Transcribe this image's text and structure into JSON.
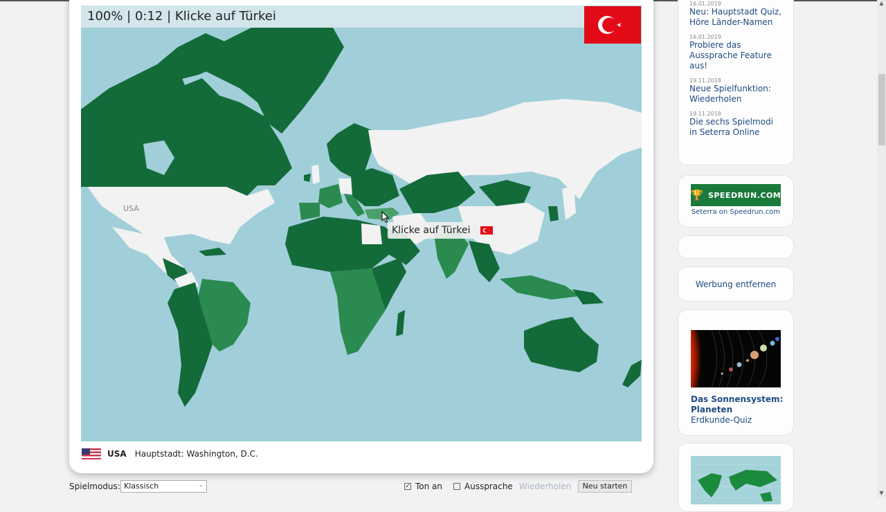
{
  "game": {
    "status_text": "100% | 0:12 | Klicke auf Türkei",
    "score_percent": 100,
    "elapsed_time": "0:12",
    "prompt": "Klicke auf Türkei",
    "target_country": "Türkei",
    "target_flag_icon": "turkey-flag-icon",
    "tooltip_text": "Klicke auf Türkei",
    "map_label_usa": "USA",
    "last_answer": {
      "flag_icon": "usa-flag-icon",
      "country": "USA",
      "capital_text": "Hauptstadt: Washington, D.C."
    },
    "colors": {
      "ocean": "#a0cfd9",
      "correct_first": "#146b3a",
      "correct_later": "#2a8a4f",
      "remaining": "#f2f2f2",
      "hover": "#4aa06a"
    }
  },
  "controls": {
    "mode_label": "Spielmodus:",
    "mode_value": "Klassisch",
    "sound_label": "Ton an",
    "sound_checked": true,
    "pronunciation_label": "Aussprache",
    "pronunciation_checked": false,
    "repeat_label": "Wiederholen",
    "restart_label": "Neu starten"
  },
  "sidebar": {
    "news": [
      {
        "date": "16.01.2019",
        "title": "Neu: Hauptstadt Quiz, Höre Länder-Namen"
      },
      {
        "date": "16.01.2019",
        "title": "Probiere das Aussprache Feature aus!"
      },
      {
        "date": "19.11.2018",
        "title": "Neue Spielfunktion: Wiederholen"
      },
      {
        "date": "19.11.2018",
        "title": "Die sechs Spielmodi in Seterra Online"
      }
    ],
    "speedrun": {
      "logo_text": "SPEEDRUN.COM",
      "caption": "Seterra on Speedrun.com"
    },
    "remove_ads_label": "Werbung entfernen",
    "promo": {
      "title_line1": "Das Sonnensystem:",
      "title_line2": "Planeten",
      "title_line3": "Erdkunde-Quiz"
    }
  }
}
